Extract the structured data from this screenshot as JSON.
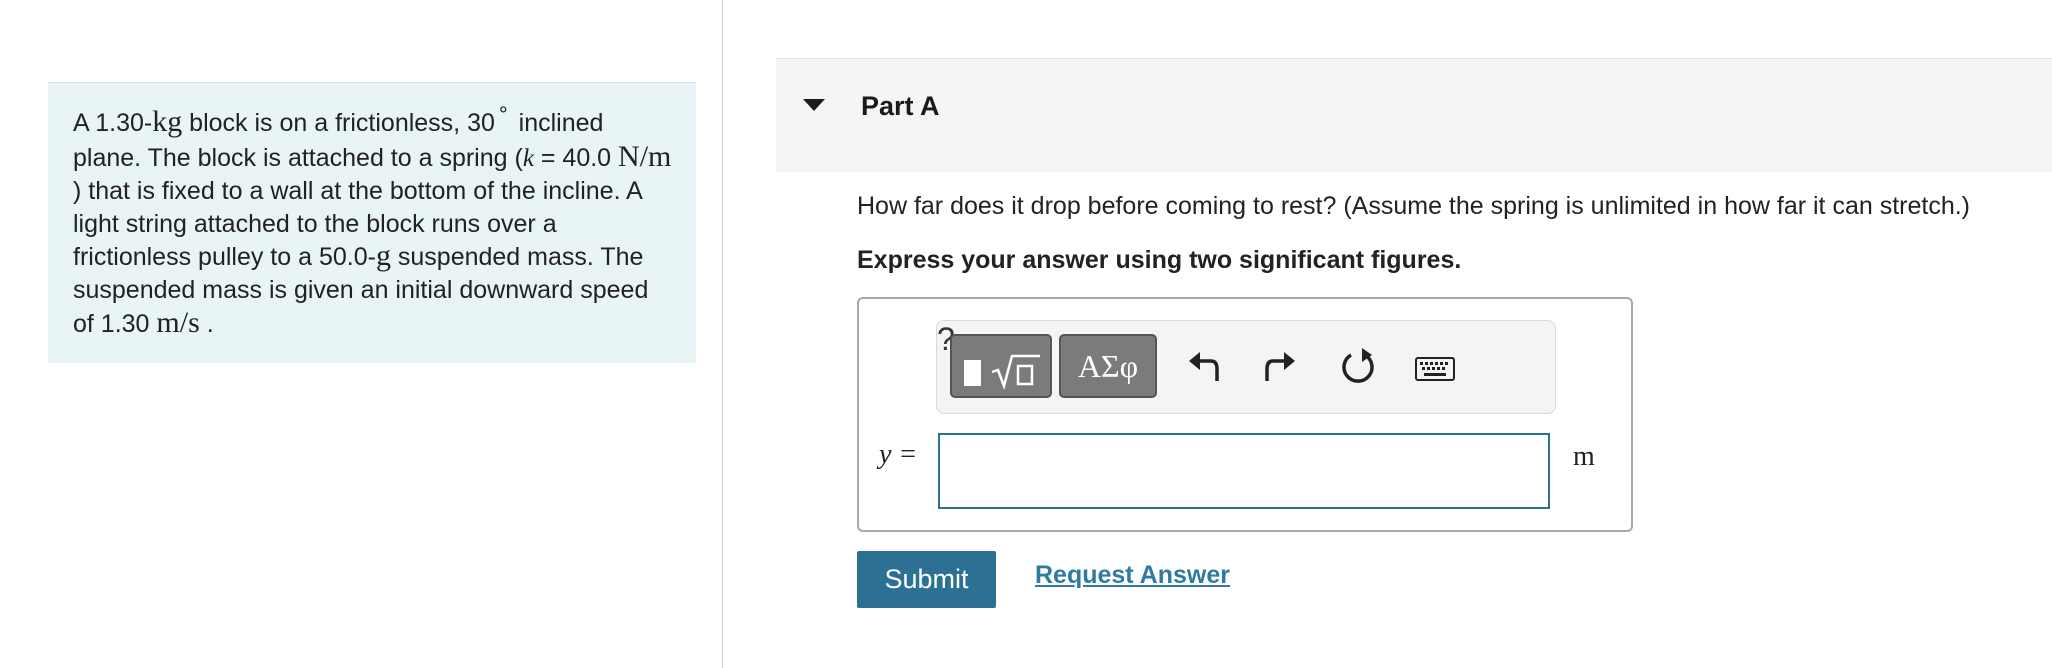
{
  "problem": {
    "segments": [
      "A 1.30-",
      "kg",
      " block is on a frictionless, 30",
      "°",
      " inclined plane. The block is attached to a spring (",
      "k",
      " = 40.0 ",
      "N/m",
      " ) that is fixed to a wall at the bottom of the incline. A light string attached to the block runs over a frictionless pulley to a 50.0-",
      "g",
      " suspended mass. The suspended mass is given an initial downward speed of 1.30 ",
      "m/s",
      " ."
    ]
  },
  "part": {
    "title": "Part A",
    "question": "How far does it drop before coming to rest? (Assume the spring is unlimited in how far it can stretch.)",
    "instruction": "Express your answer using two significant figures."
  },
  "toolbar": {
    "symbols_label": "ΑΣφ",
    "help_label": "?"
  },
  "answer": {
    "variable_label": "y =",
    "value": "",
    "unit": "m"
  },
  "actions": {
    "submit_label": "Submit",
    "request_answer_label": "Request Answer"
  },
  "colors": {
    "accent": "#2c7194",
    "link": "#2f7aa3",
    "problem_bg": "#e8f4f6",
    "part_header_bg": "#f5f5f5"
  }
}
